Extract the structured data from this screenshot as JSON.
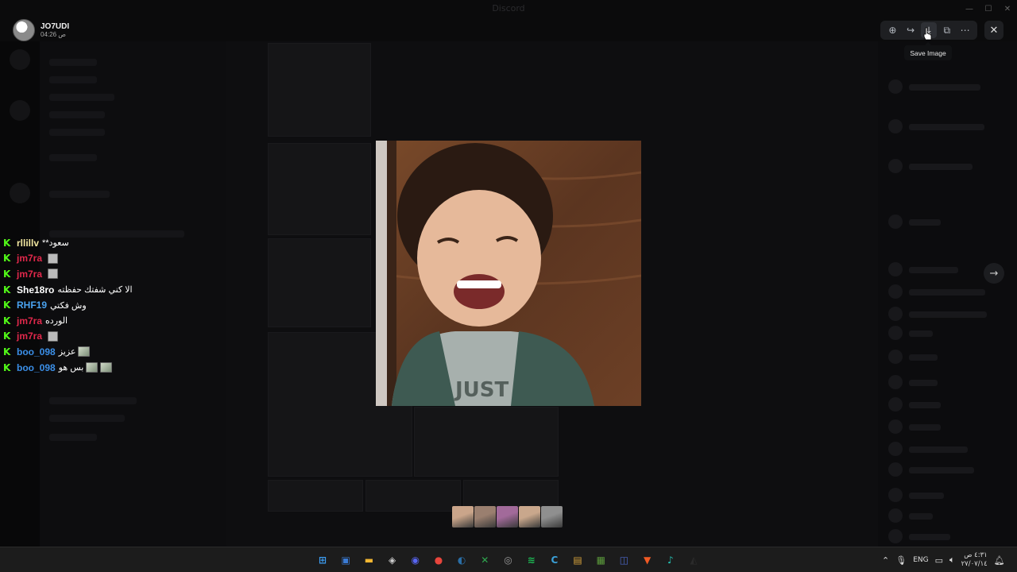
{
  "background_app": {
    "window_title": "Discord"
  },
  "author": {
    "name": "JO7UDI",
    "time": "04:26 ص"
  },
  "toolbar": {
    "tooltip": "Save Image",
    "buttons": [
      {
        "icon": "zoom-icon",
        "glyph": "⊕"
      },
      {
        "icon": "forward-icon",
        "glyph": "↪"
      },
      {
        "icon": "download-icon",
        "glyph": "⤓"
      },
      {
        "icon": "open-external-icon",
        "glyph": "⧉"
      },
      {
        "icon": "more-icon",
        "glyph": "⋯"
      }
    ],
    "close_glyph": "✕",
    "next_glyph": "→"
  },
  "window_controls": [
    "—",
    "☐",
    "✕"
  ],
  "chat_overlay": [
    {
      "user": "rllillv",
      "color": "#f2e7a0",
      "text": "**سعود",
      "emotes": 0
    },
    {
      "user": "jm7ra",
      "color": "#e0284b",
      "text": "",
      "emotes": 1
    },
    {
      "user": "jm7ra",
      "color": "#e0284b",
      "text": "",
      "emotes": 1
    },
    {
      "user": "She18ro",
      "color": "#ffffff",
      "text": "الا كني شفتك حفظته",
      "emotes": 0
    },
    {
      "user": "RHF19",
      "color": "#4aa3f0",
      "text": "وش فكتي",
      "emotes": 0
    },
    {
      "user": "jm7ra",
      "color": "#e0284b",
      "text": "الورده",
      "emotes": 0
    },
    {
      "user": "jm7ra",
      "color": "#e0284b",
      "text": "",
      "emotes": 1
    },
    {
      "user": "boo_098",
      "color": "#3b8fe8",
      "text": "عزيز",
      "emotes": 1
    },
    {
      "user": "boo_098",
      "color": "#3b8fe8",
      "text": "بس هو",
      "emotes": 2
    }
  ],
  "chat_badge_glyph": "K",
  "thumbnail_colors": [
    "#caa58a",
    "#9a7f6f",
    "#a26a9a",
    "#c9a78c",
    "#8f8f8f"
  ],
  "taskbar": {
    "apps": [
      {
        "icon": "windows-start-icon",
        "glyph": "⊞",
        "color": "#3d9cf0"
      },
      {
        "icon": "store-icon",
        "glyph": "▣",
        "color": "#3a7bd5"
      },
      {
        "icon": "file-explorer-icon",
        "glyph": "▬",
        "color": "#f2b632"
      },
      {
        "icon": "unity-icon",
        "glyph": "◈",
        "color": "#cfcfcf"
      },
      {
        "icon": "discord-icon",
        "glyph": "◉",
        "color": "#5865f2"
      },
      {
        "icon": "chrome-icon",
        "glyph": "●",
        "color": "#e8453c"
      },
      {
        "icon": "steam-icon",
        "glyph": "◐",
        "color": "#2a6ea6"
      },
      {
        "icon": "xbox-icon",
        "glyph": "✕",
        "color": "#2fa84f"
      },
      {
        "icon": "obs-icon",
        "glyph": "◎",
        "color": "#9a9a9a"
      },
      {
        "icon": "spotify-icon",
        "glyph": "≋",
        "color": "#1db954"
      },
      {
        "icon": "ccleaner-icon",
        "glyph": "C",
        "color": "#3aa0d8"
      },
      {
        "icon": "folder-icon",
        "glyph": "▤",
        "color": "#d6a23b"
      },
      {
        "icon": "minecraft-icon",
        "glyph": "▦",
        "color": "#5c9b3c"
      },
      {
        "icon": "teams-icon",
        "glyph": "◫",
        "color": "#4b67c9"
      },
      {
        "icon": "brave-icon",
        "glyph": "▼",
        "color": "#f15a24"
      },
      {
        "icon": "audio-app-icon",
        "glyph": "♪",
        "color": "#24c3b5"
      },
      {
        "icon": "epic-icon",
        "glyph": "◭",
        "color": "#2b2b2b"
      }
    ],
    "language": "ENG",
    "clock_time": "٤:٣١ ص",
    "clock_date": "٢٧/٠٧/١٤"
  }
}
